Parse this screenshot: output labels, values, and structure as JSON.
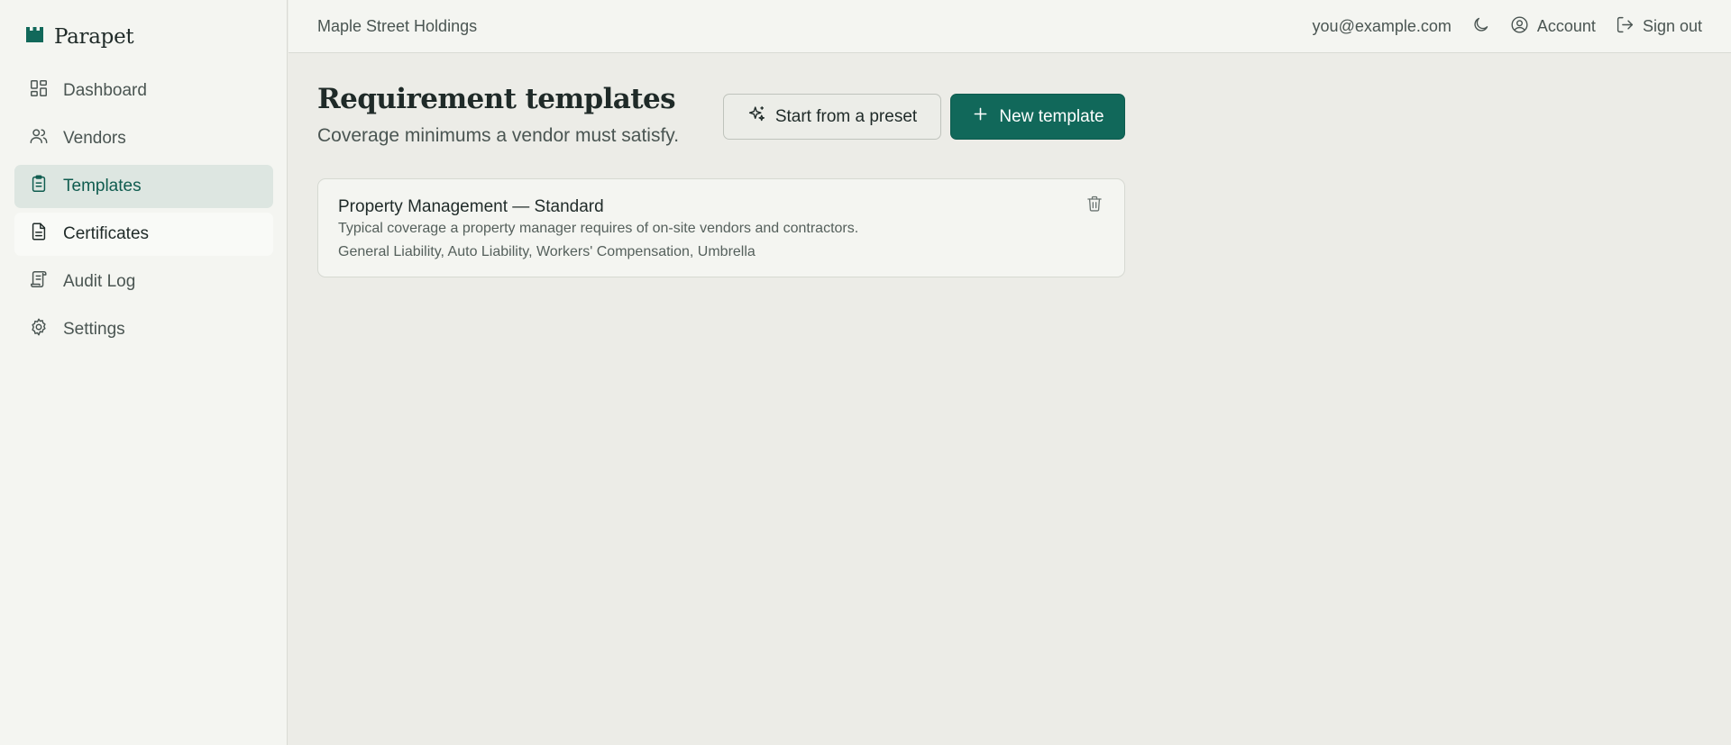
{
  "brand": {
    "name": "Parapet",
    "icon": "castle-icon"
  },
  "nav": {
    "items": [
      {
        "label": "Dashboard",
        "icon": "dashboard-icon"
      },
      {
        "label": "Vendors",
        "icon": "users-icon"
      },
      {
        "label": "Templates",
        "icon": "clipboard-icon",
        "active": true
      },
      {
        "label": "Certificates",
        "icon": "document-icon"
      },
      {
        "label": "Audit Log",
        "icon": "scroll-icon"
      },
      {
        "label": "Settings",
        "icon": "gear-icon"
      }
    ]
  },
  "topbar": {
    "org_name": "Maple Street Holdings",
    "email": "you@example.com",
    "account_label": "Account",
    "signout_label": "Sign out"
  },
  "page": {
    "title": "Requirement templates",
    "subtitle": "Coverage minimums a vendor must satisfy.",
    "preset_button": "Start from a preset",
    "new_button": "New template"
  },
  "templates": [
    {
      "name": "Property Management — Standard",
      "description": "Typical coverage a property manager requires of on-site vendors and contractors.",
      "coverages": "General Liability, Auto Liability, Workers' Compensation, Umbrella"
    }
  ],
  "colors": {
    "accent": "#11685a",
    "active_nav_bg": "#dde6e1",
    "background": "#ecece7",
    "panel": "#f4f5f1"
  }
}
